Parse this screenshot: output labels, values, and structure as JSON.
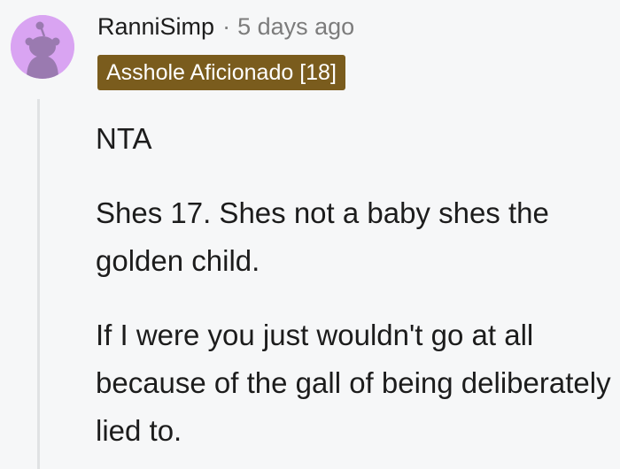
{
  "comment": {
    "username": "RanniSimp",
    "separator": "·",
    "timestamp": "5 days ago",
    "flair": "Asshole Aficionado [18]",
    "paragraphs": [
      "NTA",
      "Shes 17. Shes not a baby shes the golden child.",
      "If I were you just wouldn't go at all because of the gall of being deliberately lied to."
    ]
  },
  "colors": {
    "avatar_bg": "#d9a4f2",
    "avatar_figure": "#9a7ab0",
    "flair_bg": "#7a5c1d",
    "meta_gray": "#7c7c7c"
  },
  "icons": {
    "avatar": "reddit-snoo-avatar-icon"
  }
}
